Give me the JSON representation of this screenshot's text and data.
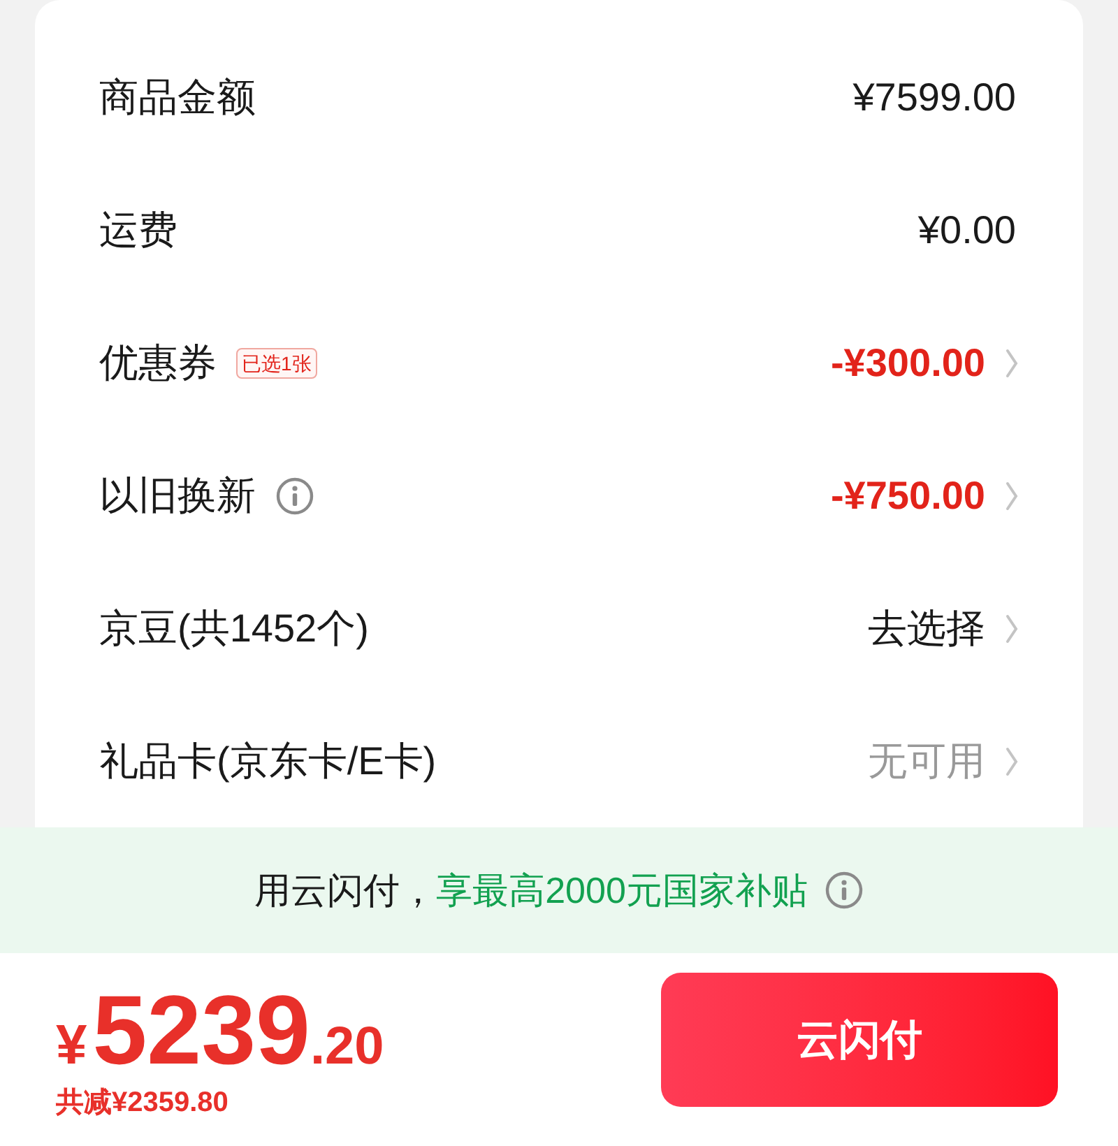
{
  "rows": [
    {
      "label": "商品金额",
      "value": "¥7599.00",
      "kind": "plain",
      "chevron": false
    },
    {
      "label": "运费",
      "value": "¥0.00",
      "kind": "plain",
      "chevron": false
    },
    {
      "label": "优惠券",
      "tag": "已选1张",
      "value": "-¥300.00",
      "kind": "discount",
      "chevron": true
    },
    {
      "label": "以旧换新",
      "info": true,
      "value": "-¥750.00",
      "kind": "discount",
      "chevron": true
    },
    {
      "label": "京豆(共1452个)",
      "value": "去选择",
      "kind": "plain",
      "chevron": true
    },
    {
      "label": "礼品卡(京东卡/E卡)",
      "value": "无可用",
      "kind": "muted",
      "chevron": true
    }
  ],
  "banner": {
    "lead": "用云闪付，",
    "highlight": "享最高2000元国家补贴",
    "info": true
  },
  "footer": {
    "currency": "¥",
    "integer": "5239",
    "decimal": ".20",
    "total_saved": "共减¥2359.80",
    "pay_button": "云闪付"
  }
}
